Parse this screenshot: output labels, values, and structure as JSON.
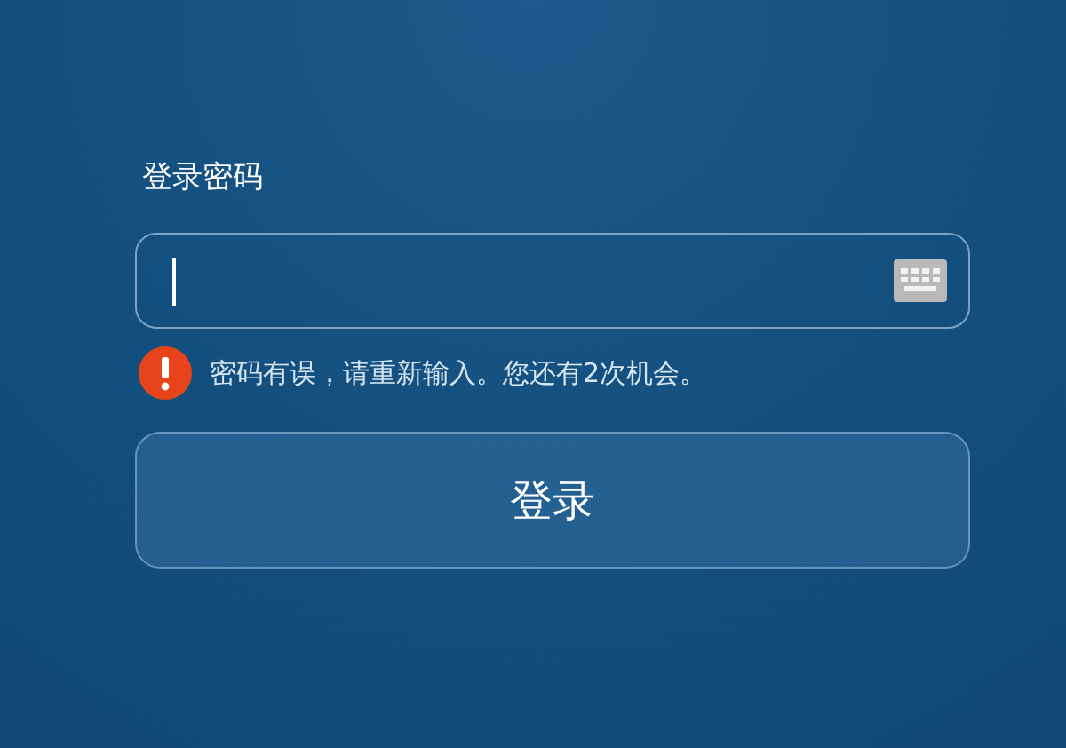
{
  "password_label": "登录密码",
  "password_field": {
    "focused": true
  },
  "error": {
    "message": "密码有误，请重新输入。您还有2次机会。"
  },
  "login_button": {
    "label": "登录"
  }
}
